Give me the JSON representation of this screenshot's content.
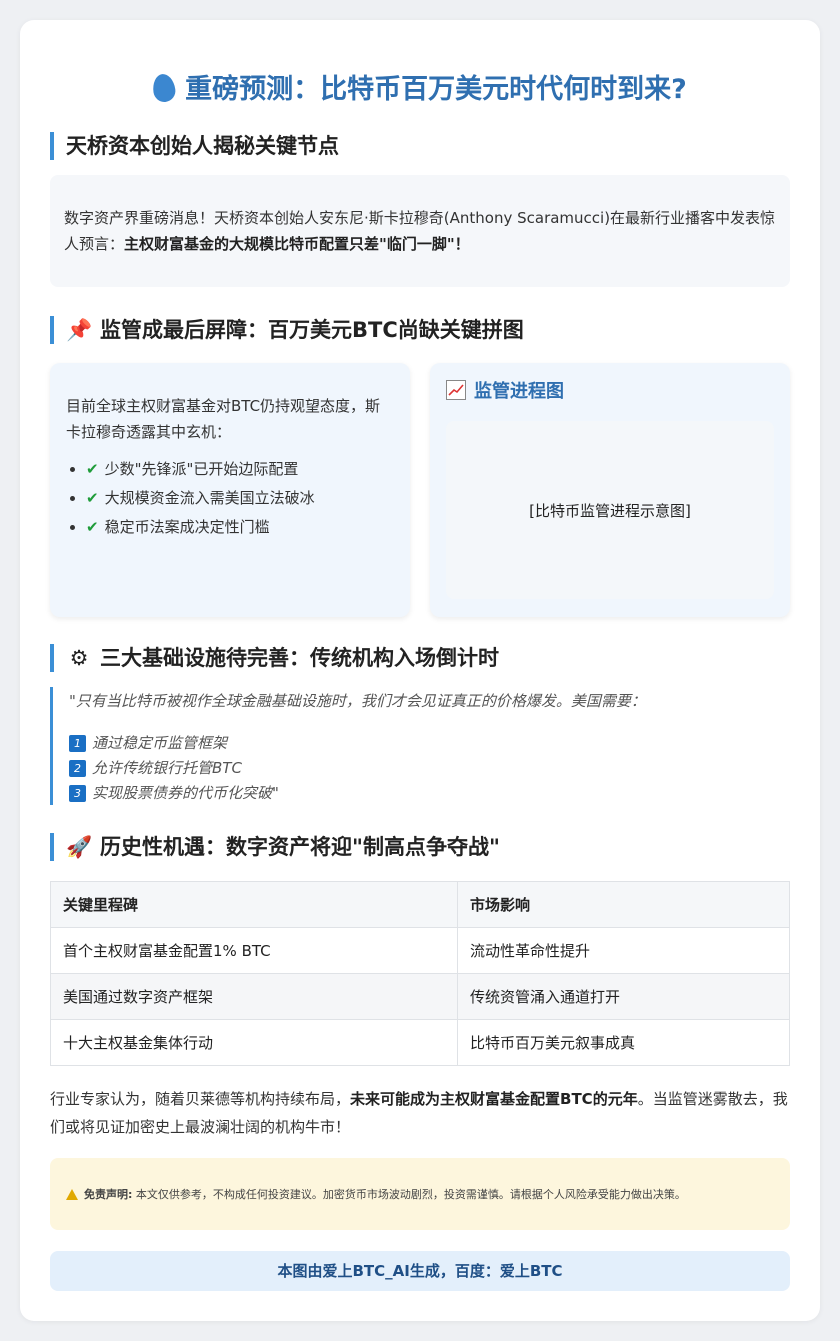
{
  "title": {
    "icon": "flame-icon",
    "text": "重磅预测：比特币百万美元时代何时到来?"
  },
  "section1": {
    "heading": "天桥资本创始人揭秘关键节点",
    "body_plain": "数字资产界重磅消息！天桥资本创始人安东尼·斯卡拉穆奇(Anthony Scaramucci)在最新行业播客中发表惊人预言：",
    "body_bold": "主权财富基金的大规模比特币配置只差\"临门一脚\"！"
  },
  "section2": {
    "icon": "pushpin-icon",
    "emoji": "📌",
    "heading": "监管成最后屏障：百万美元BTC尚缺关键拼图",
    "left_text": "目前全球主权财富基金对BTC仍持观望态度，斯卡拉穆奇透露其中玄机：",
    "bullets": [
      "少数\"先锋派\"已开始边际配置",
      "大规模资金流入需美国立法破冰",
      "稳定币法案成决定性门槛"
    ],
    "chart_title": "监管进程图",
    "chart_placeholder": "[比特币监管进程示意图]"
  },
  "section3": {
    "icon": "gear-icon",
    "emoji": "⚙",
    "heading": "三大基础设施待完善：传统机构入场倒计时",
    "quote": "\"只有当比特币被视作全球金融基础设施时，我们才会见证真正的价格爆发。美国需要：",
    "items": [
      {
        "num": "1",
        "text": "通过稳定币监管框架"
      },
      {
        "num": "2",
        "text": "允许传统银行托管BTC"
      },
      {
        "num": "3",
        "text": "实现股票债券的代币化突破\""
      }
    ]
  },
  "section4": {
    "icon": "rocket-icon",
    "emoji": "🚀",
    "heading": "历史性机遇：数字资产将迎\"制高点争夺战\"",
    "table": {
      "headers": [
        "关键里程碑",
        "市场影响"
      ],
      "rows": [
        [
          "首个主权财富基金配置1% BTC",
          "流动性革命性提升"
        ],
        [
          "美国通过数字资产框架",
          "传统资管涌入通道打开"
        ],
        [
          "十大主权基金集体行动",
          "比特币百万美元叙事成真"
        ]
      ]
    },
    "conclusion_pre": "行业专家认为，随着贝莱德等机构持续布局，",
    "conclusion_bold": "未来可能成为主权财富基金配置BTC的元年",
    "conclusion_post": "。当监管迷雾散去，我们或将见证加密史上最波澜壮阔的机构牛市！"
  },
  "disclaimer": {
    "icon": "warning-icon",
    "label": "免责声明:",
    "text": "本文仅供参考，不构成任何投资建议。加密货币市场波动剧烈，投资需谨慎。请根据个人风险承受能力做出决策。"
  },
  "footer": {
    "text": "本图由爱上BTC_AI生成，百度：爱上BTC"
  },
  "colors": {
    "accent": "#2f6fb0",
    "section_bar": "#3b8fd6",
    "panel_bg": "#f0f6fd",
    "disclaimer_bg": "#fdf6dd",
    "footer_bg": "#e3effb"
  }
}
